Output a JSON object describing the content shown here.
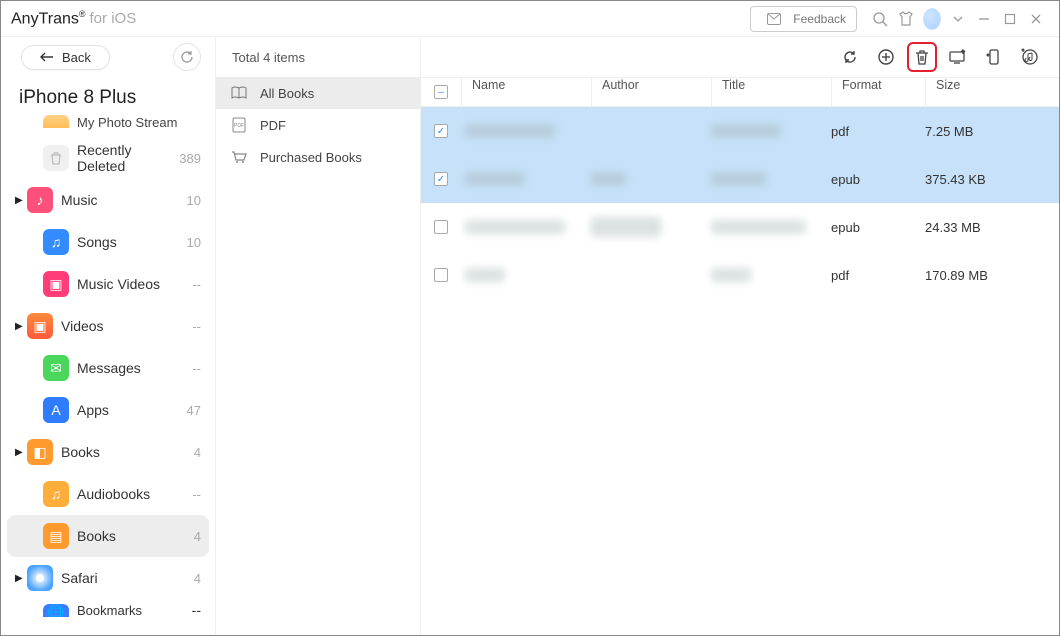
{
  "title": {
    "brand": "AnyTrans",
    "reg": "®",
    "sub": "for iOS"
  },
  "feedback_label": "Feedback",
  "back_label": "Back",
  "device_name": "iPhone 8 Plus",
  "sidebar": [
    {
      "label": "My Photo Stream",
      "count": "",
      "kind": "partial-top"
    },
    {
      "label": "Recently Deleted",
      "count": "389",
      "icon": "trash",
      "child": true
    },
    {
      "label": "Music",
      "count": "10",
      "icon": "music",
      "caret": true
    },
    {
      "label": "Songs",
      "count": "10",
      "icon": "songs",
      "child": true
    },
    {
      "label": "Music Videos",
      "count": "--",
      "icon": "pink",
      "child": true
    },
    {
      "label": "Videos",
      "count": "--",
      "icon": "videos",
      "caret": true
    },
    {
      "label": "Messages",
      "count": "--",
      "icon": "msg",
      "child": true
    },
    {
      "label": "Apps",
      "count": "47",
      "icon": "apps",
      "child": true
    },
    {
      "label": "Books",
      "count": "4",
      "icon": "books",
      "caret": true
    },
    {
      "label": "Audiobooks",
      "count": "--",
      "icon": "audiob",
      "child": true
    },
    {
      "label": "Books",
      "count": "4",
      "icon": "books",
      "child": true,
      "active": true
    },
    {
      "label": "Safari",
      "count": "4",
      "icon": "safari",
      "caret": true
    },
    {
      "label": "Bookmarks",
      "count": "--",
      "icon": "globe",
      "child": true,
      "cut": true
    }
  ],
  "mid": {
    "total_label": "Total 4 items",
    "categories": [
      {
        "label": "All Books",
        "icon": "book",
        "active": true
      },
      {
        "label": "PDF",
        "icon": "pdf"
      },
      {
        "label": "Purchased Books",
        "icon": "cart"
      }
    ]
  },
  "columns": {
    "name": "Name",
    "author": "Author",
    "title": "Title",
    "format": "Format",
    "size": "Size"
  },
  "rows": [
    {
      "checked": true,
      "format": "pdf",
      "size": "7.25 MB"
    },
    {
      "checked": true,
      "format": "epub",
      "size": "375.43 KB"
    },
    {
      "checked": false,
      "format": "epub",
      "size": "24.33 MB"
    },
    {
      "checked": false,
      "format": "pdf",
      "size": "170.89 MB"
    }
  ]
}
